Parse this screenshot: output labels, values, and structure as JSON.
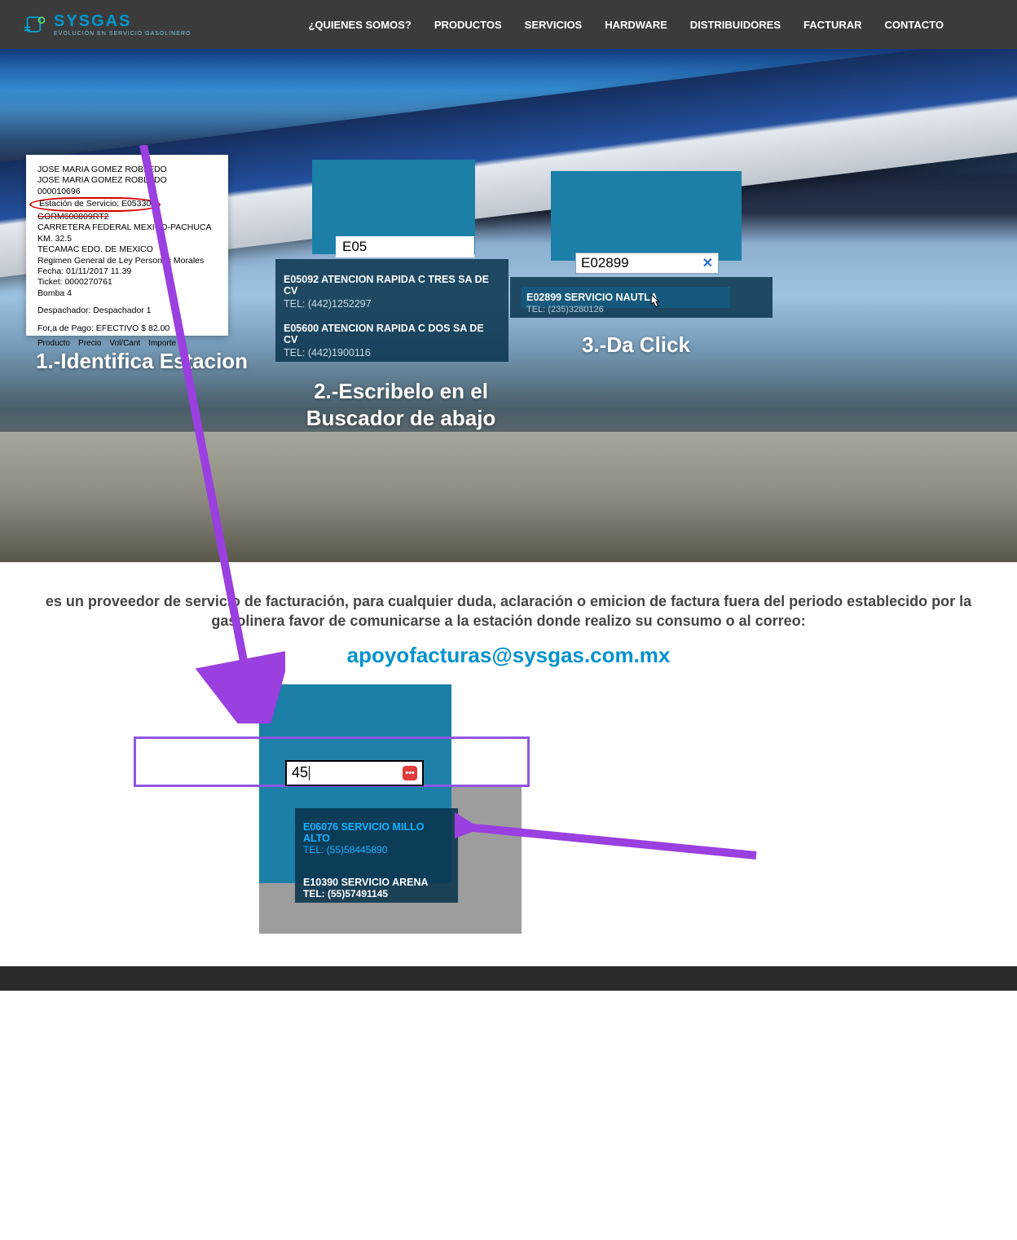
{
  "brand": {
    "name": "SYSGAS",
    "tagline": "EVOLUCIÓN EN SERVICIO GASOLINERO"
  },
  "nav": {
    "quienes": "¿QUIENES SOMOS?",
    "productos": "PRODUCTOS",
    "servicios": "SERVICIOS",
    "hardware": "HARDWARE",
    "distribuidores": "DISTRIBUIDORES",
    "facturar": "FACTURAR",
    "contacto": "CONTACTO"
  },
  "receipt": {
    "line1": "JOSE MARIA GOMEZ ROBLEDO",
    "line2": "JOSE MARIA GOMEZ ROBLEDO",
    "line3": "000010696",
    "estacion": "Estación de Servicio: E05330",
    "rfc": "GORM600809RT2",
    "dir1": "CARRETERA FEDERAL MEXICO-PACHUCA",
    "dir2": "KM. 32.5",
    "dir3": "TECAMAC EDO. DE MEXICO",
    "regimen": "Regimen General de Ley Personas Morales",
    "fecha": "Fecha: 01/11/2017  11.39",
    "ticket": "Ticket: 0000270761",
    "bomba": "Bomba 4",
    "desp": "Despachador: Despachador 1",
    "pago": "For,a de Pago: EFECTIVO $  82.00",
    "col1": "Producto",
    "col2": "Precio",
    "col3": "Vol/Cant",
    "col4": "Importe"
  },
  "steps": {
    "s1": "1.-Identifica Estacion",
    "s2": "2.-Escribelo en el Buscador de abajo",
    "s3": "3.-Da Click"
  },
  "s2_input": "E05",
  "s2_opts": {
    "a_name": "E05092  ATENCION RAPIDA C TRES SA DE CV",
    "a_tel": "TEL: (442)1252297",
    "b_name": "E05600  ATENCION RAPIDA C DOS SA DE CV",
    "b_tel": "TEL: (442)1900116"
  },
  "s3_input": "E02899",
  "s3_opt": {
    "name": "E02899  SERVICIO NAUTLA",
    "bg_tel": "TEL: (235)3280126"
  },
  "info": {
    "text": "es un proveedor de servicio de facturación, para cualquier duda, aclaración o emicion de factura fuera del periodo establecido por la gasolinera favor de comunicarse a la estación donde realizo su consumo o al correo:",
    "mail": "apoyofacturas@sysgas.com.mx"
  },
  "lower": {
    "search_value": "45",
    "a_name": "E06076  SERVICIO MILLO ALTO",
    "a_tel": "TEL: (55)58445890",
    "b_name": "E10390  SERVICIO ARENA",
    "b_tel": "TEL: (55)57491145"
  }
}
